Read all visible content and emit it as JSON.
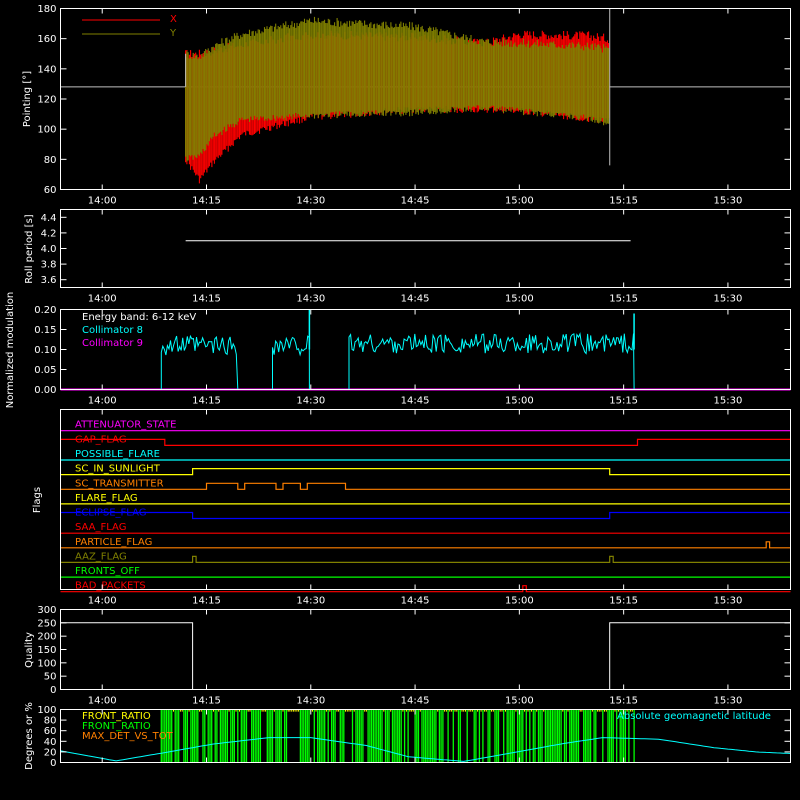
{
  "time_ticks": [
    "14:00",
    "14:15",
    "14:30",
    "14:45",
    "15:00",
    "15:15",
    "15:30"
  ],
  "colors": {
    "background": "#000000",
    "axes": "#ffffff",
    "red": "#ff0000",
    "olive": "#808000",
    "cyan": "#00ffff",
    "magenta": "#ff00ff",
    "green": "#00ff00",
    "yellow": "#ffff00",
    "orange": "#ff8000",
    "blue": "#0000ff",
    "gray": "#c0c0c0"
  },
  "chart_data": [
    {
      "type": "line",
      "ylabel": "Pointing [°]",
      "ylim": [
        60,
        180
      ],
      "yticks": [
        "60",
        "80",
        "100",
        "120",
        "140",
        "160",
        "180"
      ],
      "legend": [
        "X",
        "Y"
      ],
      "reference_line": 128,
      "data_start": "14:12",
      "data_end": "15:13",
      "series": [
        {
          "name": "X",
          "x": [
            "14:12",
            "14:14",
            "14:16",
            "14:20",
            "14:30",
            "14:45",
            "14:55",
            "15:00",
            "15:10",
            "15:13"
          ],
          "upper": [
            150,
            150,
            152,
            156,
            163,
            161,
            157,
            163,
            162,
            160
          ],
          "lower": [
            80,
            66,
            78,
            96,
            108,
            113,
            113,
            112,
            107,
            105
          ]
        },
        {
          "name": "Y",
          "x": [
            "14:12",
            "14:14",
            "14:16",
            "14:20",
            "14:30",
            "14:45",
            "14:55",
            "15:00",
            "15:10",
            "15:13"
          ],
          "upper": [
            150,
            148,
            155,
            163,
            172,
            168,
            158,
            157,
            155,
            153
          ],
          "lower": [
            80,
            82,
            95,
            106,
            109,
            111,
            114,
            112,
            107,
            104
          ]
        }
      ]
    },
    {
      "type": "line",
      "ylabel": "Roll period [s]",
      "ylim": [
        3.5,
        4.5
      ],
      "yticks": [
        "3.6",
        "3.8",
        "4.0",
        "4.2",
        "4.4"
      ],
      "series": [
        {
          "name": "",
          "x": [
            "14:12",
            "15:16"
          ],
          "values": [
            4.1,
            4.1
          ]
        }
      ]
    },
    {
      "type": "line",
      "ylabel": "Normalized modulation",
      "ylim": [
        0,
        0.2
      ],
      "yticks": [
        "0.00",
        "0.05",
        "0.10",
        "0.15",
        "0.20"
      ],
      "legend": [
        "Energy band: 6-12 keV",
        "Collimator 8",
        "Collimator 9"
      ],
      "active_intervals": [
        {
          "start": "14:08.5",
          "end": "14:19.5",
          "level": 0.11
        },
        {
          "start": "14:24.5",
          "end": "14:29.8",
          "level": 0.11
        },
        {
          "start": "14:35.5",
          "end": "15:16.5",
          "level": 0.115
        }
      ],
      "spikes": [
        {
          "x": "14:29.8",
          "value": 0.2
        },
        {
          "x": "15:16.5",
          "value": 0.19
        }
      ]
    },
    {
      "type": "line",
      "ylabel": "Flags",
      "flags": [
        {
          "name": "ATTENUATOR_STATE",
          "color": "#ff00ff",
          "steps": [
            [
              "13:54",
              0
            ]
          ]
        },
        {
          "name": "GAP_FLAG",
          "color": "#ff0000",
          "steps": [
            [
              "13:54",
              1
            ],
            [
              "14:09",
              0
            ],
            [
              "15:17",
              1
            ]
          ]
        },
        {
          "name": "POSSIBLE_FLARE",
          "color": "#00ffff",
          "steps": [
            [
              "13:54",
              0
            ]
          ]
        },
        {
          "name": "SC_IN_SUNLIGHT",
          "color": "#ffff00",
          "steps": [
            [
              "13:54",
              0
            ],
            [
              "14:13",
              1
            ],
            [
              "15:13",
              0
            ]
          ]
        },
        {
          "name": "SC_TRANSMITTER",
          "color": "#ff8000",
          "steps": [
            [
              "13:54",
              0
            ],
            [
              "14:15",
              1
            ],
            [
              "14:19.5",
              0
            ],
            [
              "14:20.5",
              1
            ],
            [
              "14:25",
              0
            ],
            [
              "14:26",
              1
            ],
            [
              "14:28.5",
              0
            ],
            [
              "14:29.5",
              1
            ],
            [
              "14:35",
              0
            ]
          ]
        },
        {
          "name": "FLARE_FLAG",
          "color": "#ffff00",
          "steps": [
            [
              "13:54",
              0
            ]
          ]
        },
        {
          "name": "ECLIPSE_FLAG",
          "color": "#0000ff",
          "steps": [
            [
              "13:54",
              1
            ],
            [
              "14:13",
              0
            ],
            [
              "15:13",
              1
            ]
          ]
        },
        {
          "name": "SAA_FLAG",
          "color": "#ff0000",
          "steps": [
            [
              "13:54",
              0
            ]
          ]
        },
        {
          "name": "PARTICLE_FLAG",
          "color": "#ff8000",
          "steps": [
            [
              "13:54",
              0
            ],
            [
              "15:35.5",
              1
            ],
            [
              "15:36",
              0
            ]
          ]
        },
        {
          "name": "AAZ_FLAG",
          "color": "#808000",
          "steps": [
            [
              "13:54",
              0
            ],
            [
              "14:13",
              1
            ],
            [
              "14:13.5",
              0
            ],
            [
              "15:13",
              1
            ],
            [
              "15:13.5",
              0
            ]
          ]
        },
        {
          "name": "FRONTS_OFF",
          "color": "#00ff00",
          "steps": [
            [
              "13:54",
              0
            ]
          ]
        },
        {
          "name": "BAD_PACKETS",
          "color": "#ff0000",
          "steps": [
            [
              "13:54",
              0
            ],
            [
              "15:00.5",
              1
            ],
            [
              "15:01",
              0
            ]
          ]
        }
      ]
    },
    {
      "type": "line",
      "ylabel": "Quality",
      "ylim": [
        0,
        300
      ],
      "yticks": [
        "0",
        "50",
        "100",
        "150",
        "200",
        "250",
        "300"
      ],
      "series": [
        {
          "name": "",
          "x": [
            "13:54",
            "14:13",
            "14:13",
            "15:13",
            "15:13",
            "15:39"
          ],
          "values": [
            250,
            250,
            0,
            0,
            250,
            250
          ]
        }
      ]
    },
    {
      "type": "area",
      "ylabel": "Degrees or %",
      "ylim": [
        0,
        100
      ],
      "yticks": [
        "0",
        "20",
        "40",
        "60",
        "80",
        "100"
      ],
      "legend": [
        "FRONT_RATIO",
        "FRONT_RATIO",
        "MAX_DET_VS_TOT"
      ],
      "annotation": "Absolute geomagnetic latitude",
      "front_ratio_interval": {
        "start": "14:08.5",
        "end": "15:16.5"
      },
      "geomagnetic_latitude": {
        "x": [
          "13:54",
          "14:02",
          "14:10",
          "14:16",
          "14:24",
          "14:30",
          "14:38",
          "14:44",
          "14:52",
          "14:58",
          "15:06",
          "15:12",
          "15:20",
          "15:28",
          "15:34",
          "15:39"
        ],
        "values": [
          22,
          3,
          21,
          35,
          47,
          47,
          32,
          11,
          2,
          16,
          35,
          47,
          44,
          28,
          20,
          17
        ]
      }
    }
  ]
}
